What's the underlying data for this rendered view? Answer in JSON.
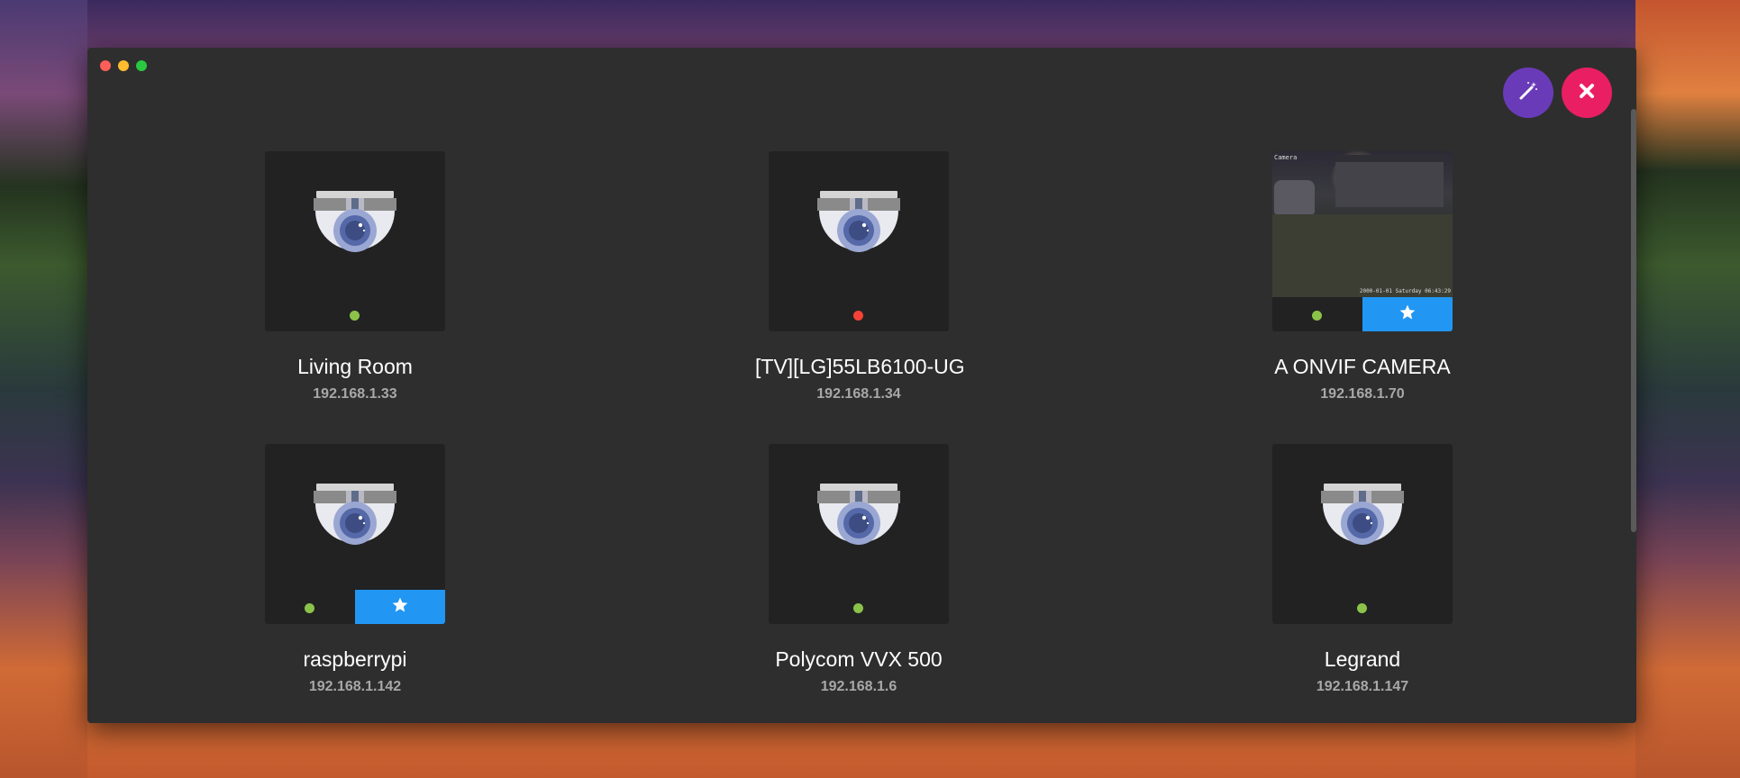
{
  "window": {
    "actions": {
      "wand_icon": "magic-wand-icon",
      "close_icon": "close-icon"
    }
  },
  "colors": {
    "online": "#8bc34a",
    "offline": "#f44336",
    "favorite": "#2196f3",
    "wand_button": "#6a3bb8",
    "close_button": "#e91e63"
  },
  "devices": [
    {
      "name": "Living Room",
      "ip": "192.168.1.33",
      "status": "online",
      "favorite": false,
      "snapshot": false
    },
    {
      "name": "[TV][LG]55LB6100-UG",
      "ip": "192.168.1.34",
      "status": "offline",
      "favorite": false,
      "snapshot": false
    },
    {
      "name": "A ONVIF CAMERA",
      "ip": "192.168.1.70",
      "status": "online",
      "favorite": true,
      "snapshot": true,
      "snapshot_label": "Camera",
      "snapshot_timestamp": "2000-01-01 Saturday 06:43:29"
    },
    {
      "name": "raspberrypi",
      "ip": "192.168.1.142",
      "status": "online",
      "favorite": true,
      "snapshot": false
    },
    {
      "name": "Polycom VVX 500",
      "ip": "192.168.1.6",
      "status": "online",
      "favorite": false,
      "snapshot": false
    },
    {
      "name": "Legrand",
      "ip": "192.168.1.147",
      "status": "online",
      "favorite": false,
      "snapshot": false
    }
  ]
}
